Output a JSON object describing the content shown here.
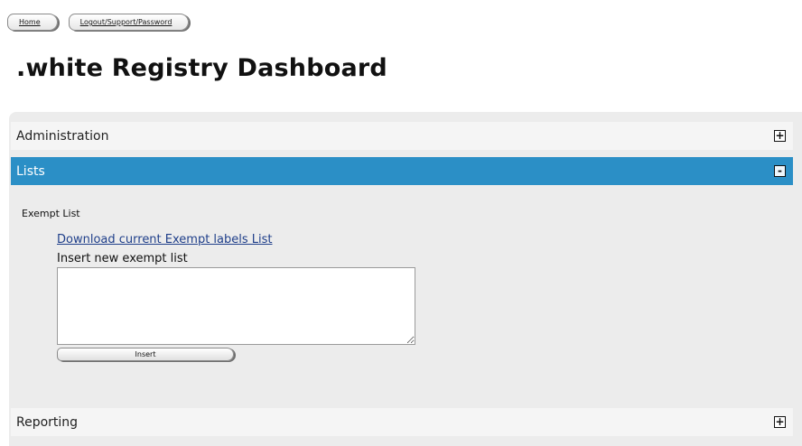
{
  "nav": {
    "home_label": "Home",
    "logout_label": "Logout/Support/Password"
  },
  "page": {
    "title": ".white Registry Dashboard"
  },
  "sections": {
    "administration": {
      "label": "Administration",
      "toggle": "+"
    },
    "lists": {
      "label": "Lists",
      "toggle": "-"
    },
    "reporting": {
      "label": "Reporting",
      "toggle": "+"
    }
  },
  "lists_section": {
    "subtitle": "Exempt List",
    "download_link": "Download current Exempt labels List",
    "insert_label": "Insert new exempt list",
    "textarea_value": "",
    "insert_button": "Insert"
  },
  "colors": {
    "accent": "#2b8fc6",
    "panel_bg": "#ececec",
    "link": "#1f3f8a"
  }
}
